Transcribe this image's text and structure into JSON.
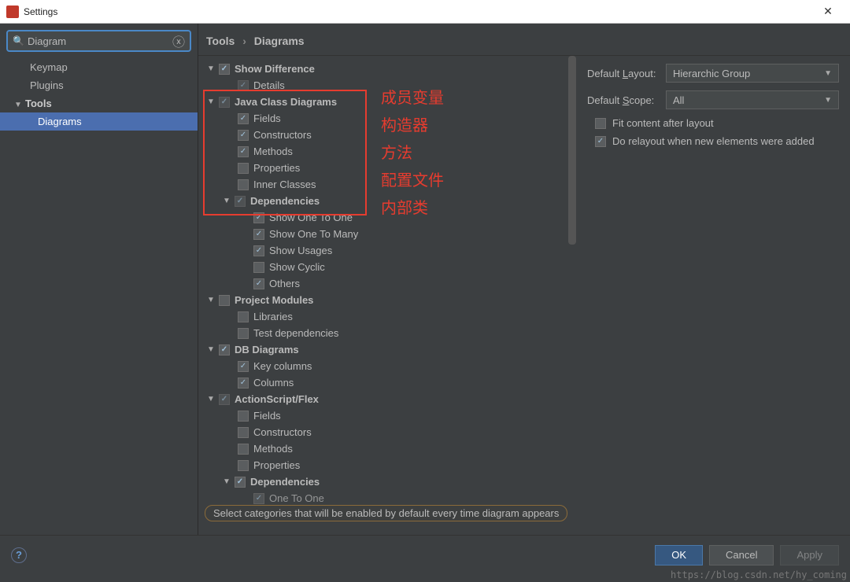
{
  "window": {
    "title": "Settings"
  },
  "search": {
    "value": "Diagram"
  },
  "sidebar": {
    "items": [
      "Keymap",
      "Plugins"
    ],
    "group": "Tools",
    "selected": "Diagrams"
  },
  "breadcrumb": {
    "a": "Tools",
    "b": "Diagrams"
  },
  "tree": {
    "show_difference": "Show Difference",
    "details": "Details",
    "java_class": "Java Class Diagrams",
    "fields": "Fields",
    "constructors": "Constructors",
    "methods": "Methods",
    "properties": "Properties",
    "inner_classes": "Inner Classes",
    "dependencies": "Dependencies",
    "show_one_one": "Show One To One",
    "show_one_many": "Show One To Many",
    "show_usages": "Show Usages",
    "show_cyclic": "Show Cyclic",
    "others": "Others",
    "project_modules": "Project Modules",
    "libraries": "Libraries",
    "test_deps": "Test dependencies",
    "db_diagrams": "DB Diagrams",
    "key_columns": "Key columns",
    "columns": "Columns",
    "actionscript": "ActionScript/Flex",
    "as_fields": "Fields",
    "as_constructors": "Constructors",
    "as_methods": "Methods",
    "as_properties": "Properties",
    "as_dependencies": "Dependencies",
    "as_one_to_one": "One To One"
  },
  "annotations": {
    "a1": "成员变量",
    "a2": "构造器",
    "a3": "方法",
    "a4": "配置文件",
    "a5": "内部类"
  },
  "options": {
    "layout_label": "Default Layout:",
    "layout_value": "Hierarchic Group",
    "scope_label": "Default Scope:",
    "scope_value": "All",
    "fit_label": "Fit content after layout",
    "relayout_label": "Do relayout when new elements were added"
  },
  "hint": "Select categories that will be enabled by default every time diagram appears",
  "buttons": {
    "ok": "OK",
    "cancel": "Cancel",
    "apply": "Apply"
  },
  "watermark": "https://blog.csdn.net/hy_coming"
}
